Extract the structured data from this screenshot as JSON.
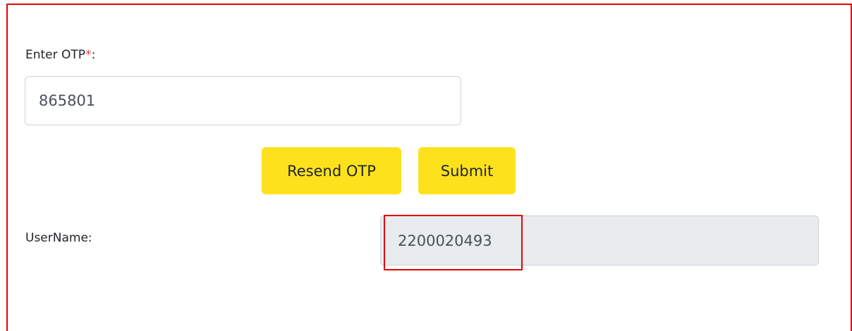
{
  "otp": {
    "label": "Enter OTP",
    "required_marker": "*",
    "label_suffix": ":",
    "value": "865801"
  },
  "buttons": {
    "resend_label": "Resend OTP",
    "submit_label": "Submit"
  },
  "username": {
    "label": "UserName:",
    "value": "2200020493"
  },
  "colors": {
    "button_bg": "#fde11d",
    "required_marker": "#e0434b",
    "highlight_border": "#e60000",
    "readonly_bg": "#e9ecef"
  }
}
